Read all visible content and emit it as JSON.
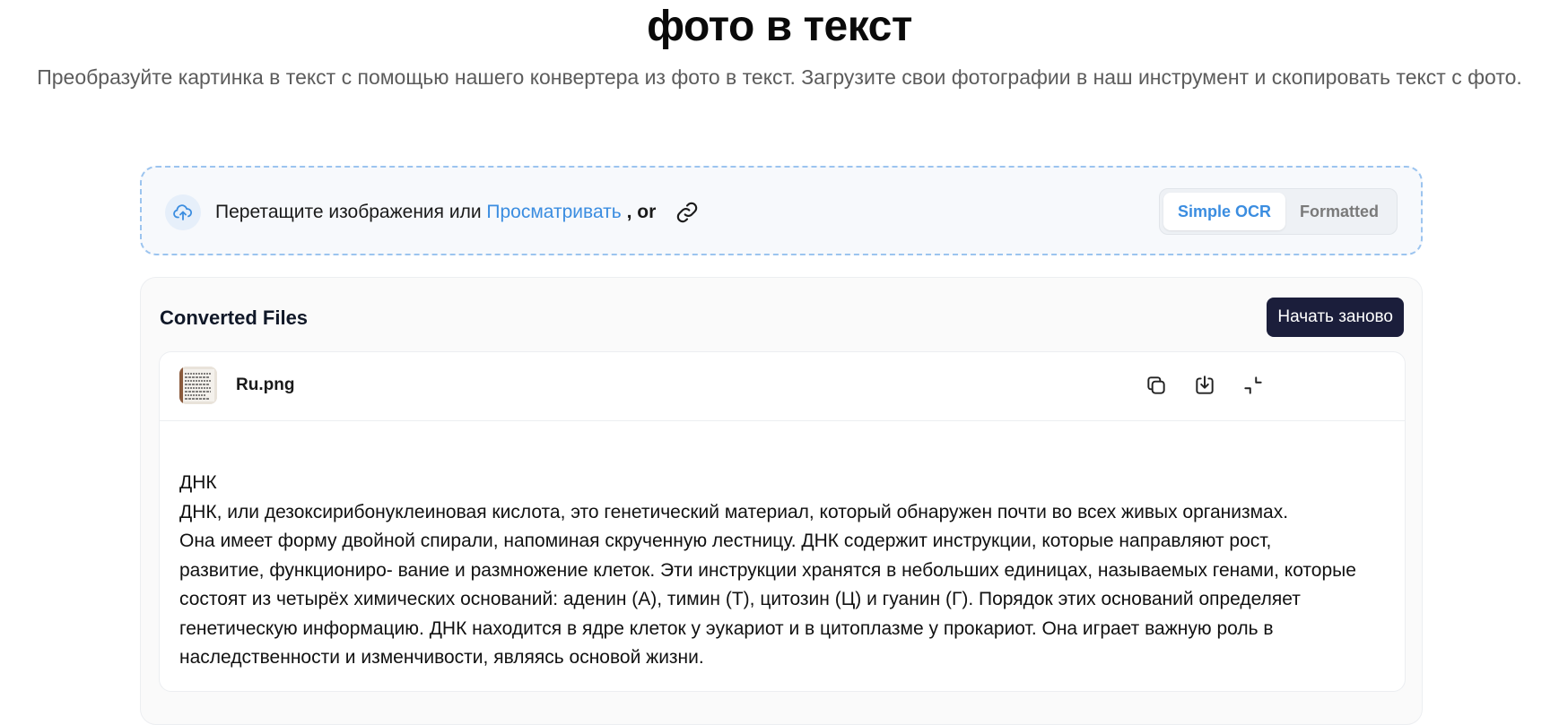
{
  "page": {
    "title": "фото в текст",
    "subtitle": "Преобразуйте картинка в текст с помощью нашего конвертера из фото в текст. Загрузите свои фотографии в наш инструмент и скопировать текст с фото."
  },
  "uploader": {
    "prompt": "Перетащите изображения или ",
    "browse_link": "Просматривать",
    "or_text": " , or",
    "upload_icon": "cloud-upload-icon",
    "link_icon": "link-icon"
  },
  "mode_toggle": {
    "options": [
      "Simple OCR",
      "Formatted"
    ],
    "selected": "Simple OCR"
  },
  "converted": {
    "title": "Converted Files",
    "restart_label": "Начать заново",
    "file": {
      "name": "Ru.png",
      "actions": [
        "copy-icon",
        "download-icon",
        "collapse-icon"
      ],
      "text_lines": [
        "ДНК",
        "ДНК, или дезоксирибонуклеиновая кислота, это генетический материал, который обнаружен почти во всех живых организмах.",
        "Она имеет форму двойной спирали, напоминая скрученную лестницу. ДНК содержит инструкции, которые направляют рост,",
        "развитие, функциониро- вание и размножение клеток. Эти инструкции хранятся в небольших единицах, называемых генами, которые",
        "состоят из четырёх химических оснований: аденин (А), тимин (Т), цитозин (Ц) и гуанин (Г). Порядок этих оснований определяет",
        "генетическую информацию. ДНК находится в ядре клеток у эукариот и в цитоплазме у прокариот. Она играет важную роль в",
        "наследственности и изменчивости, являясь основой жизни."
      ]
    }
  },
  "colors": {
    "accent_blue": "#3b8de0",
    "dark_button": "#1b1e3b",
    "dropzone_border": "#9cc4ef"
  }
}
